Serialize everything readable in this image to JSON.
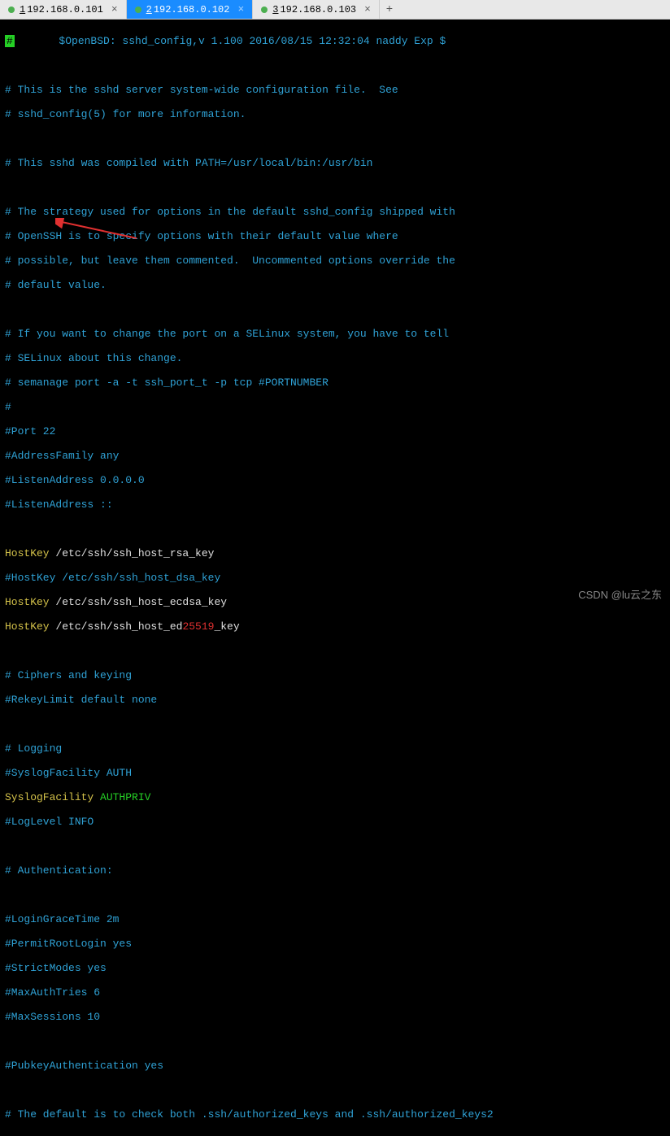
{
  "tabs": [
    {
      "num": "1",
      "label": "192.168.0.101",
      "active": false
    },
    {
      "num": "2",
      "label": "192.168.0.102",
      "active": true
    },
    {
      "num": "3",
      "label": "192.168.0.103",
      "active": false
    }
  ],
  "addtab": "+",
  "cursor": "#",
  "lines": {
    "l1_pre": "       $OpenBSD: sshd_config,v 1.100 2016/08/15 12:32:04 naddy Exp $",
    "l3": "# This is the sshd server system-wide configuration file.  See",
    "l4": "# sshd_config(5) for more information.",
    "l6": "# This sshd was compiled with PATH=/usr/local/bin:/usr/bin",
    "l8": "# The strategy used for options in the default sshd_config shipped with",
    "l9": "# OpenSSH is to specify options with their default value where",
    "l10": "# possible, but leave them commented.  Uncommented options override the",
    "l11": "# default value.",
    "l13": "# If you want to change the port on a SELinux system, you have to tell",
    "l14": "# SELinux about this change.",
    "l15": "# semanage port -a -t ssh_port_t -p tcp #PORTNUMBER",
    "l16": "#",
    "l17": "#Port 22",
    "l18": "#AddressFamily any",
    "l19": "#ListenAddress 0.0.0.0",
    "l20": "#ListenAddress ::",
    "l22a": "HostKey",
    "l22b": " /etc/ssh/ssh_host_rsa_key",
    "l23": "#HostKey /etc/ssh/ssh_host_dsa_key",
    "l24a": "HostKey",
    "l24b": " /etc/ssh/ssh_host_ecdsa_key",
    "l25a": "HostKey",
    "l25b": " /etc/ssh/ssh_host_ed",
    "l25c": "25519",
    "l25d": "_key",
    "l27": "# Ciphers and keying",
    "l28": "#RekeyLimit default none",
    "l30": "# Logging",
    "l31": "#SyslogFacility AUTH",
    "l32a": "SyslogFacility ",
    "l32b": "AUTHPRIV",
    "l33": "#LogLevel INFO",
    "l35": "# Authentication:",
    "l37": "#LoginGraceTime 2m",
    "l38": "#PermitRootLogin yes",
    "l39": "#StrictModes yes",
    "l40": "#MaxAuthTries 6",
    "l41": "#MaxSessions 10",
    "l43": "#PubkeyAuthentication yes",
    "l45": "# The default is to check both .ssh/authorized_keys and .ssh/authorized_keys2"
  },
  "watermark": "CSDN @lu云之东"
}
